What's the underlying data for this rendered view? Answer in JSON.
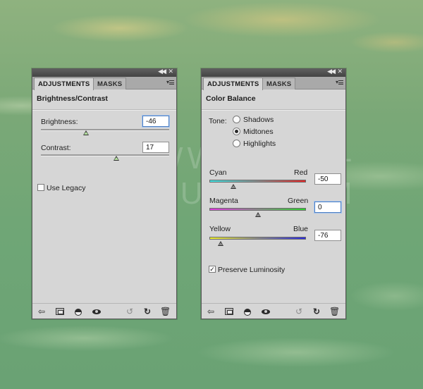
{
  "watermark": "WWW.PSD-DUDE.COM",
  "left_panel": {
    "tabs": [
      "ADJUSTMENTS",
      "MASKS"
    ],
    "title": "Brightness/Contrast",
    "brightness": {
      "label": "Brightness:",
      "value": "-46",
      "level": 0.35
    },
    "contrast": {
      "label": "Contrast:",
      "value": "17",
      "level": 0.59
    },
    "use_legacy": {
      "label": "Use Legacy",
      "checked": false
    }
  },
  "right_panel": {
    "tabs": [
      "ADJUSTMENTS",
      "MASKS"
    ],
    "title": "Color Balance",
    "tone": {
      "label": "Tone:",
      "options": [
        "Shadows",
        "Midtones",
        "Highlights"
      ],
      "selected": "Midtones"
    },
    "sliders": [
      {
        "left": "Cyan",
        "right": "Red",
        "value": "-50",
        "level": 0.25
      },
      {
        "left": "Magenta",
        "right": "Green",
        "value": "0",
        "level": 0.5
      },
      {
        "left": "Yellow",
        "right": "Blue",
        "value": "-76",
        "level": 0.12
      }
    ],
    "preserve_luminosity": {
      "label": "Preserve Luminosity",
      "checked": true
    }
  },
  "icons": {
    "collapse": "double-left-arrow-icon",
    "close": "close-icon",
    "menu": "panel-menu-icon",
    "footer": [
      "back-arrow-icon",
      "clip-to-layer-icon",
      "visibility-toggle-icon",
      "eye-icon",
      "view-previous-icon",
      "reset-icon",
      "trash-icon"
    ]
  },
  "colors": {
    "panel_bg": "#d6d6d6",
    "titlebar": "#4a4a4a",
    "focus": "#4d7fc2"
  }
}
